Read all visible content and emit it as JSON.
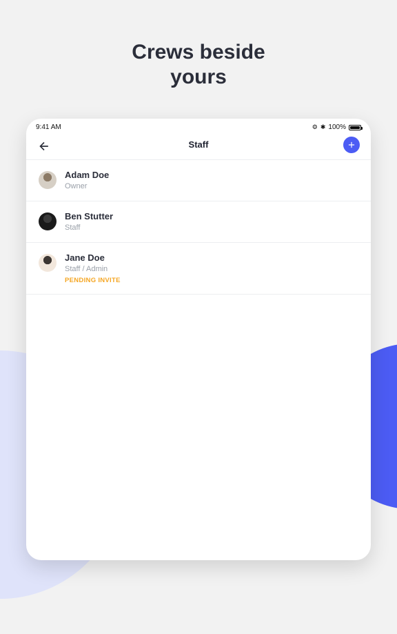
{
  "headline_line1": "Crews beside",
  "headline_line2": "yours",
  "statusbar": {
    "time": "9:41 AM",
    "alarm": "⏰",
    "bluetooth": "✱",
    "battery_pct": "100%"
  },
  "header": {
    "title": "Staff"
  },
  "staff": [
    {
      "name": "Adam Doe",
      "role": "Owner",
      "status": "",
      "avatar_bg": "#d6cfc5",
      "avatar_accent": "#8c7a66"
    },
    {
      "name": "Ben Stutter",
      "role": "Staff",
      "status": "",
      "avatar_bg": "#1a1a1a",
      "avatar_accent": "#3a3a3a"
    },
    {
      "name": "Jane Doe",
      "role": "Staff / Admin",
      "status": "PENDING INVITE",
      "avatar_bg": "#f2e7dc",
      "avatar_accent": "#3d3733"
    }
  ]
}
